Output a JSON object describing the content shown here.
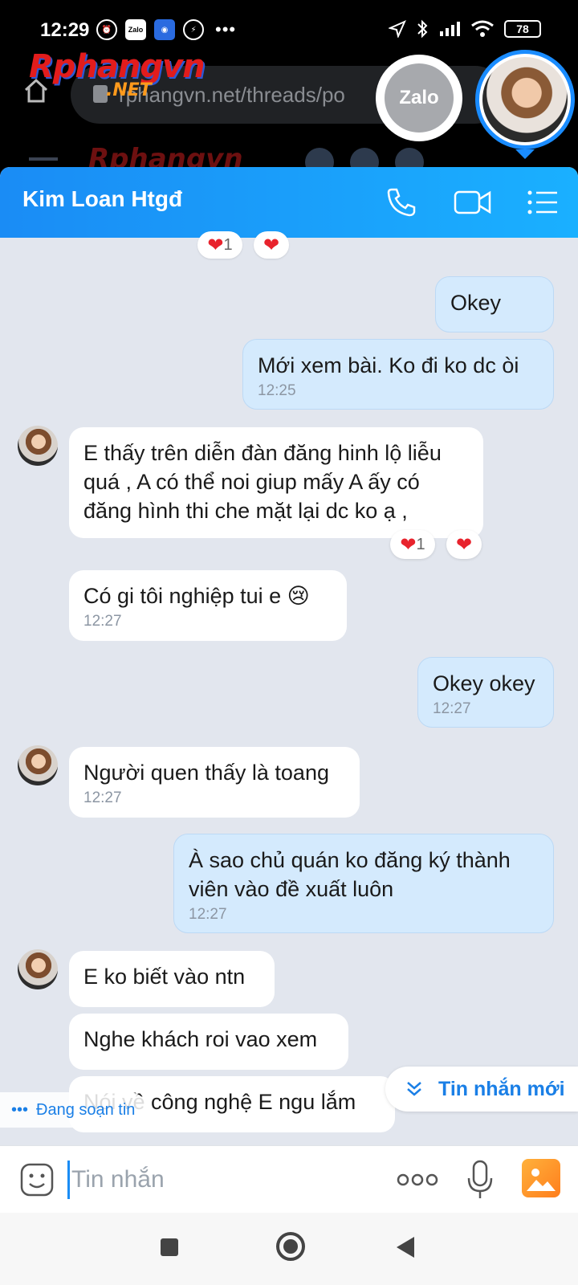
{
  "status_bar": {
    "time": "12:29",
    "left_icons": [
      "alarm-icon",
      "zalo-icon",
      "hotspot-icon",
      "messenger-icon"
    ],
    "zalo_small": "Zalo",
    "more": "•••",
    "battery": "78"
  },
  "browser": {
    "logo": "Rphangvn",
    "logo_suffix": ".NET",
    "url": "rphangvn.net/threads/po",
    "ghost_logo": "Rphangvn"
  },
  "floating": {
    "zalo_label": "Zalo"
  },
  "chat": {
    "contact_name": "Kim Loan Htgđ",
    "top_reaction_count": "1",
    "messages": [
      {
        "from": "me",
        "text": "Okey"
      },
      {
        "from": "me",
        "text": "Mới xem bài. Ko đi ko dc òi",
        "time": "12:25"
      },
      {
        "from": "them",
        "text": "E thấy trên diễn đàn đăng hinh lộ liễu quá , A có thể noi giup mấy A ấy có đăng hình thi che mặt lại dc ko ạ ,",
        "reaction_count": "1"
      },
      {
        "from": "them",
        "text": "Có gi tôi nghiệp tui e 😢",
        "time": "12:27"
      },
      {
        "from": "me",
        "text": "Okey okey",
        "time": "12:27"
      },
      {
        "from": "them",
        "text": "Người quen thấy là toang",
        "time": "12:27"
      },
      {
        "from": "me",
        "text": "À sao chủ quán ko đăng ký thành viên vào đề xuất luôn",
        "time": "12:27"
      },
      {
        "from": "them",
        "text": "E ko biết vào ntn"
      },
      {
        "from": "them",
        "text": "Nghe khách roi vao xem"
      },
      {
        "from": "them",
        "text": "Nói về công nghệ E ngu lắm"
      }
    ],
    "new_messages_label": "Tin nhắn mới",
    "typing_label": "Đang soạn tin"
  },
  "composer": {
    "placeholder": "Tin nhắn"
  },
  "colors": {
    "header_start": "#1a8cf5",
    "header_end": "#1ab0ff",
    "my_bubble": "#d4eafd",
    "their_bubble": "#ffffff",
    "chat_bg": "#e2e6ee",
    "accent": "#1a7fe6",
    "heart": "#e8232d"
  }
}
